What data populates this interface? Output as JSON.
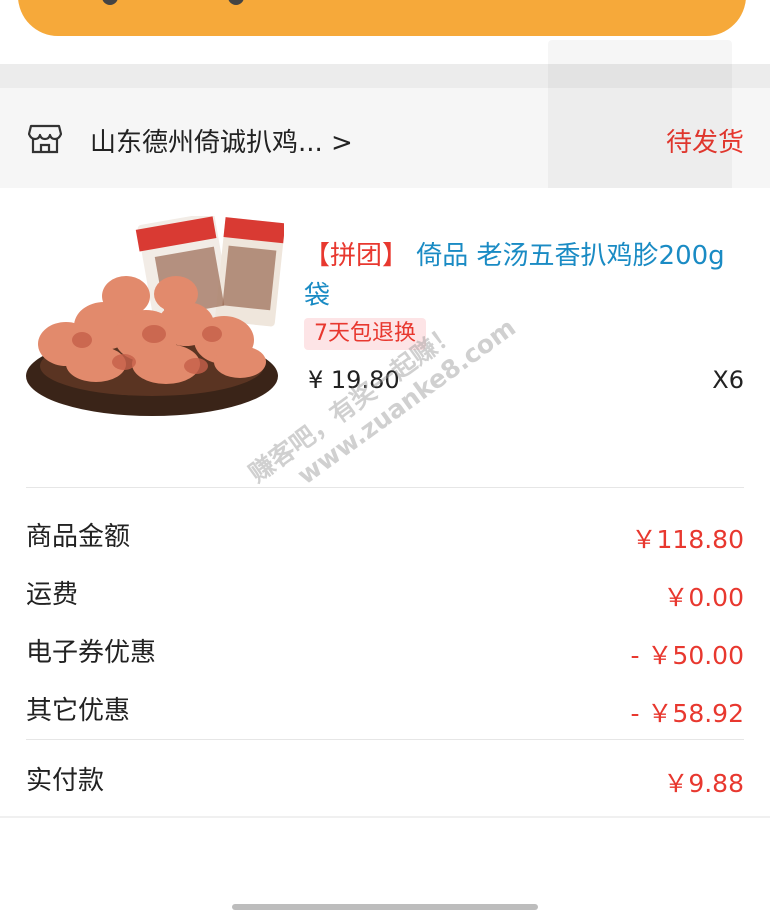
{
  "store": {
    "name": "山东德州倚诚扒鸡... >",
    "status": "待发货"
  },
  "product": {
    "group_tag": "【拼团】",
    "title": " 倚品 老汤五香扒鸡胗200g袋",
    "return_badge": "7天包退换",
    "price": "¥ 19.80",
    "quantity": "X6"
  },
  "summary": {
    "goods_amount_label": "商品金额",
    "goods_amount_value": "￥118.80",
    "shipping_label": "运费",
    "shipping_value": "￥0.00",
    "coupon_label": "电子券优惠",
    "coupon_value": "- ￥50.00",
    "other_label": "其它优惠",
    "other_value": "- ￥58.92",
    "paid_label": "实付款",
    "paid_value": "￥9.88"
  },
  "watermark": {
    "line1": "赚客吧，有奖一起赚！",
    "line2": "www.zuanke8.com"
  },
  "colors": {
    "accent": "#e8382f",
    "link": "#1a8bc4",
    "banner": "#f6a93a"
  }
}
